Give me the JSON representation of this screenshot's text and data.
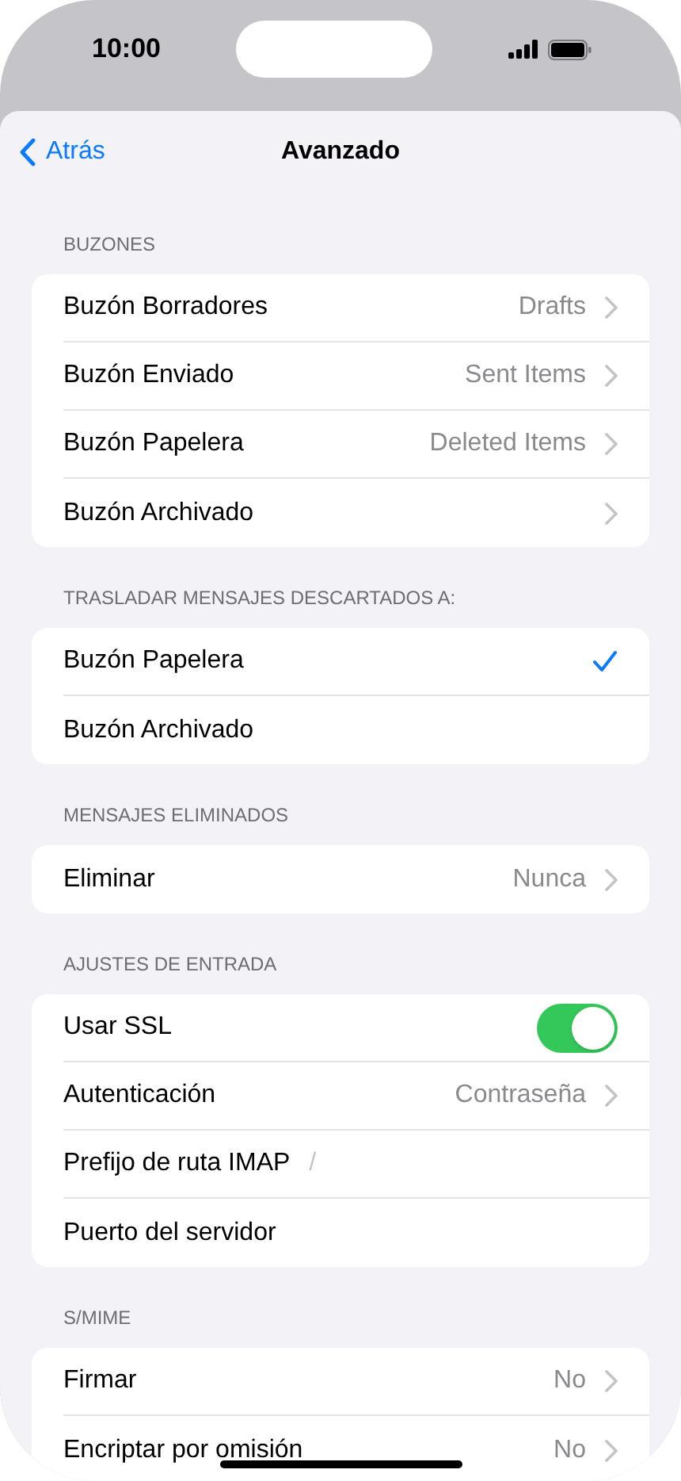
{
  "status_bar": {
    "time": "10:00"
  },
  "nav": {
    "back": "Atrás",
    "title": "Avanzado"
  },
  "sections": [
    {
      "header": "BUZONES",
      "rows": [
        {
          "kind": "link",
          "label": "Buzón Borradores",
          "value": "Drafts"
        },
        {
          "kind": "link",
          "label": "Buzón Enviado",
          "value": "Sent Items"
        },
        {
          "kind": "link",
          "label": "Buzón Papelera",
          "value": "Deleted Items"
        },
        {
          "kind": "link",
          "label": "Buzón Archivado"
        }
      ]
    },
    {
      "header": "TRASLADAR MENSAJES DESCARTADOS A:",
      "rows": [
        {
          "kind": "choice",
          "label": "Buzón Papelera",
          "selected": true
        },
        {
          "kind": "choice",
          "label": "Buzón Archivado",
          "selected": false
        }
      ]
    },
    {
      "header": "MENSAJES ELIMINADOS",
      "rows": [
        {
          "kind": "link",
          "label": "Eliminar",
          "value": "Nunca"
        }
      ]
    },
    {
      "header": "AJUSTES DE ENTRADA",
      "rows": [
        {
          "kind": "toggle",
          "label": "Usar SSL",
          "on": true
        },
        {
          "kind": "link",
          "label": "Autenticación",
          "value": "Contraseña"
        },
        {
          "kind": "field",
          "label": "Prefijo de ruta IMAP",
          "value": "/"
        },
        {
          "kind": "field",
          "label": "Puerto del servidor"
        }
      ]
    },
    {
      "header": "S/MIME",
      "rows": [
        {
          "kind": "link",
          "label": "Firmar",
          "value": "No"
        },
        {
          "kind": "link",
          "label": "Encriptar por omisión",
          "value": "No"
        }
      ]
    }
  ]
}
